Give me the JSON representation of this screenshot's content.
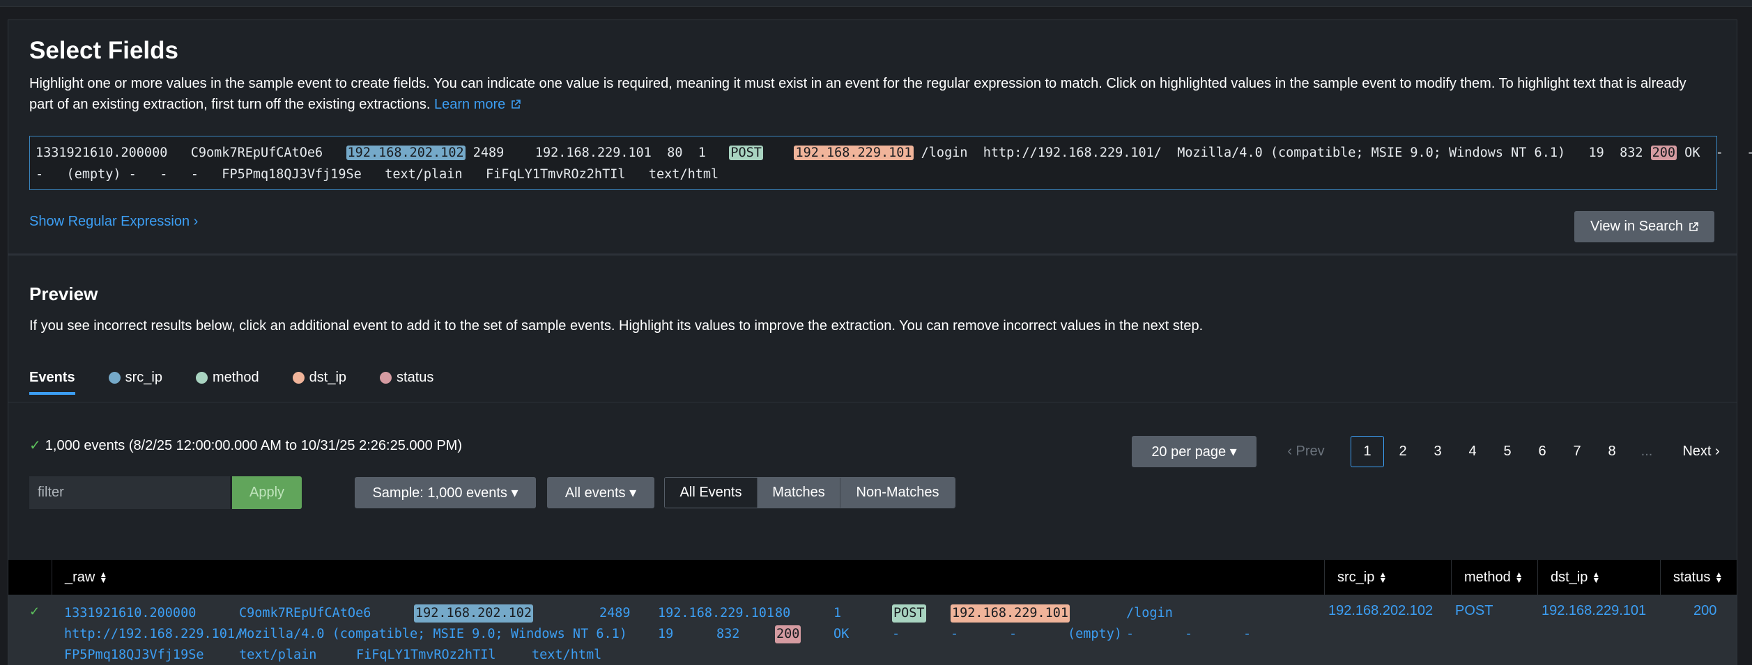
{
  "select_fields": {
    "title": "Select Fields",
    "description": "Highlight one or more values in the sample event to create fields. You can indicate one value is required, meaning it must exist in an event for the regular expression to match. Click on highlighted values in the sample event to modify them. To highlight text that is already part of an existing extraction, first turn off the existing extractions.",
    "learn_more": "Learn more",
    "sample_event": {
      "t1": "1331921610.200000   C9omk7REpUfCAtOe6   ",
      "src_ip": "192.168.202.102",
      "t2": " 2489    192.168.229.101  80  1   ",
      "method": "POST",
      "t3": "    ",
      "dst_ip": "192.168.229.101",
      "t4": " /login  http://192.168.229.101/  Mozilla/4.0 (compatible; MSIE 9.0; Windows NT 6.1)   19  832 ",
      "status": "200",
      "t5": " OK  -   -",
      "line2": "-   (empty) -   -   -   FP5Pmq18QJ3Vfj19Se   text/plain   FiFqLY1TmvROz2hTIl   text/html"
    },
    "show_regex": "Show Regular Expression ›",
    "view_in_search": "View in Search"
  },
  "preview": {
    "title": "Preview",
    "description": "If you see incorrect results below, click an additional event to add it to the set of sample events. Highlight its values to improve the extraction. You can remove incorrect values in the next step."
  },
  "tabs": [
    {
      "label": "Events",
      "color": ""
    },
    {
      "label": "src_ip",
      "color": "#75a9c9"
    },
    {
      "label": "method",
      "color": "#a9d4c1"
    },
    {
      "label": "dst_ip",
      "color": "#f0b49a"
    },
    {
      "label": "status",
      "color": "#d59ba1"
    }
  ],
  "events_summary": {
    "check": "✓",
    "text": "1,000 events (8/2/25 12:00:00.000 AM to 10/31/25 2:26:25.000 PM)"
  },
  "pagination": {
    "per_page": "20 per page ▾",
    "prev": "‹ Prev",
    "pages": [
      "1",
      "2",
      "3",
      "4",
      "5",
      "6",
      "7",
      "8"
    ],
    "ellipsis": "...",
    "next": "Next ›",
    "current": "1"
  },
  "filter": {
    "placeholder": "filter",
    "apply": "Apply"
  },
  "sample_dropdown": "Sample: 1,000 events ▾",
  "all_events_dropdown": "All events ▾",
  "segmented": [
    "All Events",
    "Matches",
    "Non-Matches"
  ],
  "table": {
    "columns": [
      "_raw",
      "src_ip",
      "method",
      "dst_ip",
      "status"
    ],
    "rows": [
      {
        "check": "✓",
        "raw": {
          "a1": "1331921610.200000",
          "a2": "C9omk7REpUfCAtOe6",
          "src_ip": "192.168.202.102",
          "a3": "2489",
          "a4": "192.168.229.101",
          "a5": "80",
          "a6": "1",
          "method": "POST",
          "dst_ip": "192.168.229.101",
          "a7": "/login",
          "b1": "http://192.168.229.101/",
          "b2": "Mozilla/4.0 (compatible; MSIE 9.0; Windows NT 6.1)",
          "b3": "19",
          "b4": "832",
          "status": "200",
          "b5": "OK",
          "b6": "-",
          "b7": "-",
          "b8": "-",
          "b9": "(empty)",
          "b10": "-",
          "b11": "-",
          "b12": "-",
          "c1": "FP5Pmq18QJ3Vfj19Se",
          "c2": "text/plain",
          "c3": "FiFqLY1TmvROz2hTIl",
          "c4": "text/html"
        },
        "src_ip": "192.168.202.102",
        "method": "POST",
        "dst_ip": "192.168.229.101",
        "status": "200"
      }
    ]
  }
}
